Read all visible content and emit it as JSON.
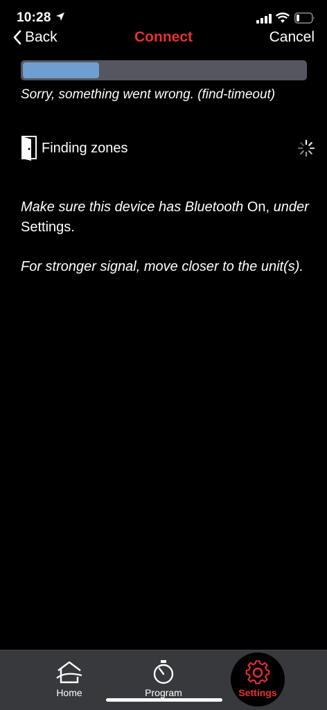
{
  "status_bar": {
    "time": "10:28",
    "icons": [
      "location-arrow-icon",
      "cellular-signal-icon",
      "wifi-icon",
      "battery-icon"
    ]
  },
  "nav": {
    "back_label": "Back",
    "title": "Connect",
    "cancel_label": "Cancel"
  },
  "progress": {
    "fraction": 0.27,
    "fill_color": "#6f9fd1",
    "track_color": "#55565f"
  },
  "error_message": "Sorry, something went wrong. (find-timeout)",
  "finding": {
    "label": "Finding zones",
    "icon": "door-icon",
    "status_icon": "spinner-icon"
  },
  "hints": {
    "bluetooth_p1": "Make sure this device has Bluetooth",
    "bluetooth_on": "On,",
    "bluetooth_p2": "under",
    "bluetooth_settings": "Settings.",
    "signal": "For stronger signal, move closer to the unit(s)."
  },
  "tabs": [
    {
      "label": "Home",
      "icon": "house-icon",
      "active": false
    },
    {
      "label": "Program",
      "icon": "stopwatch-icon",
      "active": false
    },
    {
      "label": "Settings",
      "icon": "gear-icon",
      "active": true
    }
  ],
  "colors": {
    "accent": "#e8312f",
    "background": "#000000",
    "tabbar": "#38393d"
  }
}
